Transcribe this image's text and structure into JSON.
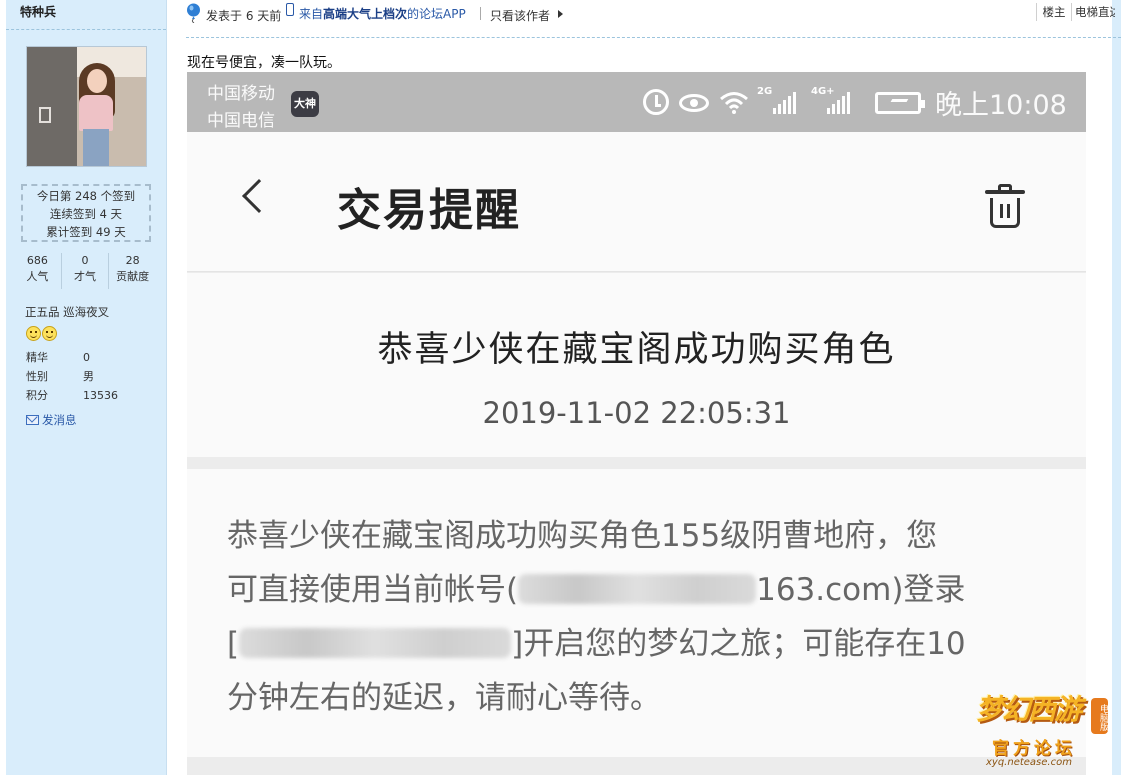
{
  "sidebar": {
    "username": "特种兵",
    "checkin": {
      "today": "今日第 248 个签到",
      "streak": "连续签到 4 天",
      "total": "累计签到 49 天"
    },
    "stats": [
      {
        "value": "686",
        "label": "人气"
      },
      {
        "value": "0",
        "label": "才气"
      },
      {
        "value": "28",
        "label": "贡献度"
      }
    ],
    "rank": "正五品 巡海夜叉",
    "profile": [
      {
        "key": "精华",
        "value": "0"
      },
      {
        "key": "性别",
        "value": "男"
      },
      {
        "key": "积分",
        "value": "13536"
      }
    ],
    "send_message": "发消息"
  },
  "post": {
    "posted": "发表于 6 天前",
    "app_prefix": "来自",
    "app_bold": "高端大气上档次",
    "app_suffix": "的论坛APP",
    "only_author": "只看该作者",
    "floor": "楼主",
    "elevator": "电梯直达",
    "text": "现在号便宜，凑一队玩。"
  },
  "screenshot": {
    "status": {
      "carrier1": "中国移动",
      "carrier2": "中国电信",
      "app_badge": "大神",
      "net1": "2G",
      "net2": "4G+",
      "time": "晚上10:08"
    },
    "title": "交易提醒",
    "card_title": "恭喜少侠在藏宝阁成功购买角色",
    "card_time": "2019-11-02 22:05:31",
    "message": {
      "line1": "恭喜少侠在藏宝阁成功购买角色155级阴曹地府，您",
      "line2_a": "可直接使用当前帐号(",
      "line2_b": "163.com)登录",
      "line3_a": "[",
      "line3_b": "]开启您的梦幻之旅；可能存在10",
      "line4": "分钟左右的延迟，请耐心等待。"
    }
  },
  "watermark": {
    "main": "梦幻西游",
    "badge": "电脑版",
    "sub": "官方论坛",
    "url": "xyq.netease.com"
  },
  "colors": {
    "sidebar_bg": "#d9edfb",
    "link": "#2a59a7",
    "status_bar": "#b8b8b8"
  }
}
